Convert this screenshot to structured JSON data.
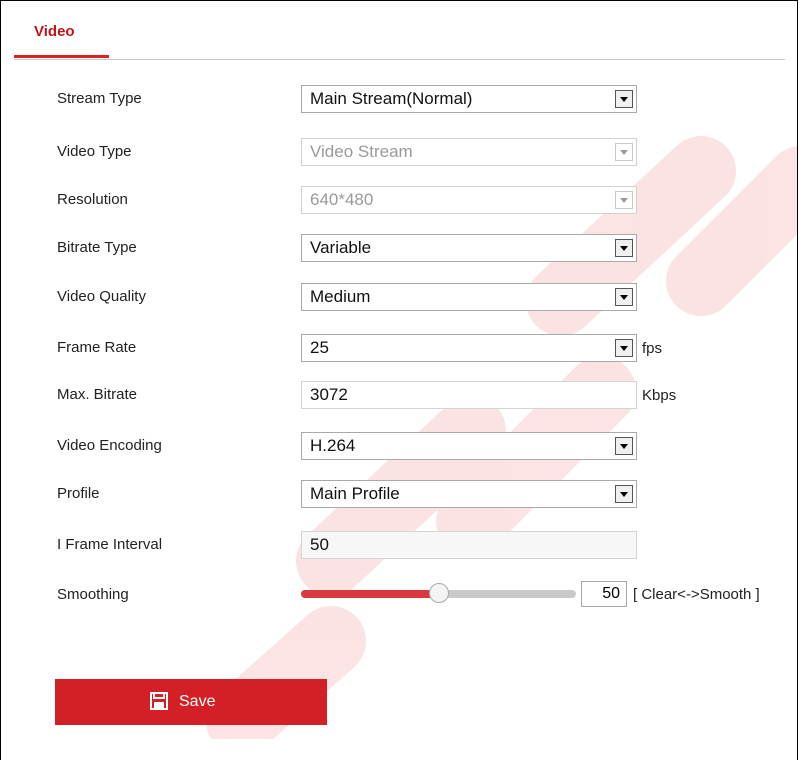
{
  "tab": {
    "label": "Video"
  },
  "fields": {
    "stream_type": {
      "label": "Stream Type",
      "value": "Main Stream(Normal)"
    },
    "video_type": {
      "label": "Video Type",
      "value": "Video Stream"
    },
    "resolution": {
      "label": "Resolution",
      "value": "640*480"
    },
    "bitrate_type": {
      "label": "Bitrate Type",
      "value": "Variable"
    },
    "video_quality": {
      "label": "Video Quality",
      "value": "Medium"
    },
    "frame_rate": {
      "label": "Frame Rate",
      "value": "25",
      "unit": "fps"
    },
    "max_bitrate": {
      "label": "Max. Bitrate",
      "value": "3072",
      "unit": "Kbps"
    },
    "video_encoding": {
      "label": "Video Encoding",
      "value": "H.264"
    },
    "profile": {
      "label": "Profile",
      "value": "Main Profile"
    },
    "i_frame_interval": {
      "label": "I Frame Interval",
      "value": "50"
    },
    "smoothing": {
      "label": "Smoothing",
      "value": "50",
      "level": 0.5,
      "hint": "[ Clear<->Smooth ]"
    }
  },
  "save": {
    "label": "Save"
  },
  "colors": {
    "accent": "#d31f26",
    "tab_text": "#c01515",
    "slider_fill": "#d93a3f"
  }
}
